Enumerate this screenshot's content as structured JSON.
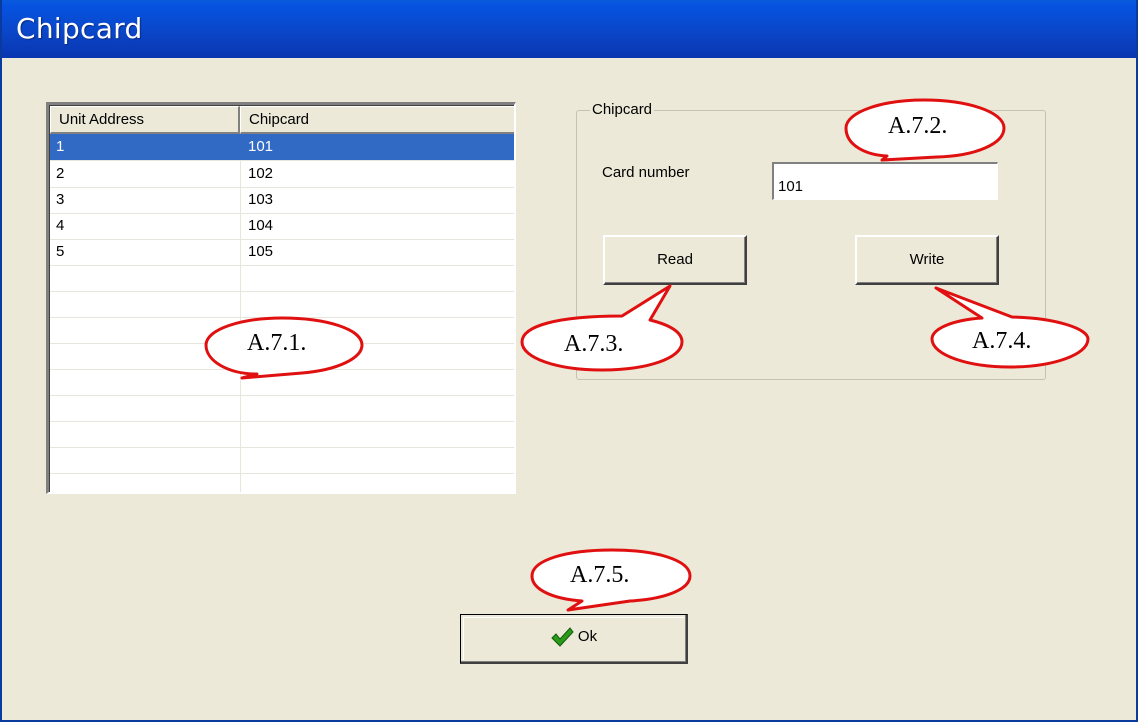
{
  "window": {
    "title": "Chipcard"
  },
  "list": {
    "columns": [
      "Unit Address",
      "Chipcard"
    ],
    "rows": [
      {
        "address": "1",
        "chipcard": "101",
        "selected": true
      },
      {
        "address": "2",
        "chipcard": "102",
        "selected": false
      },
      {
        "address": "3",
        "chipcard": "103",
        "selected": false
      },
      {
        "address": "4",
        "chipcard": "104",
        "selected": false
      },
      {
        "address": "5",
        "chipcard": "105",
        "selected": false
      }
    ]
  },
  "group": {
    "label": "Chipcard",
    "card_number_label": "Card number",
    "card_number_value": "101",
    "read_label": "Read",
    "write_label": "Write"
  },
  "ok_label": "Ok",
  "callouts": {
    "list": "A.7.1.",
    "card_number": "A.7.2.",
    "read": "A.7.3.",
    "write": "A.7.4.",
    "ok": "A.7.5."
  },
  "colors": {
    "title_bar": "#0a46c8",
    "selection": "#316ac5",
    "dialog_bg": "#ece9d8",
    "callout_border": "#e01010"
  },
  "icons": {
    "ok": "checkmark-icon"
  }
}
